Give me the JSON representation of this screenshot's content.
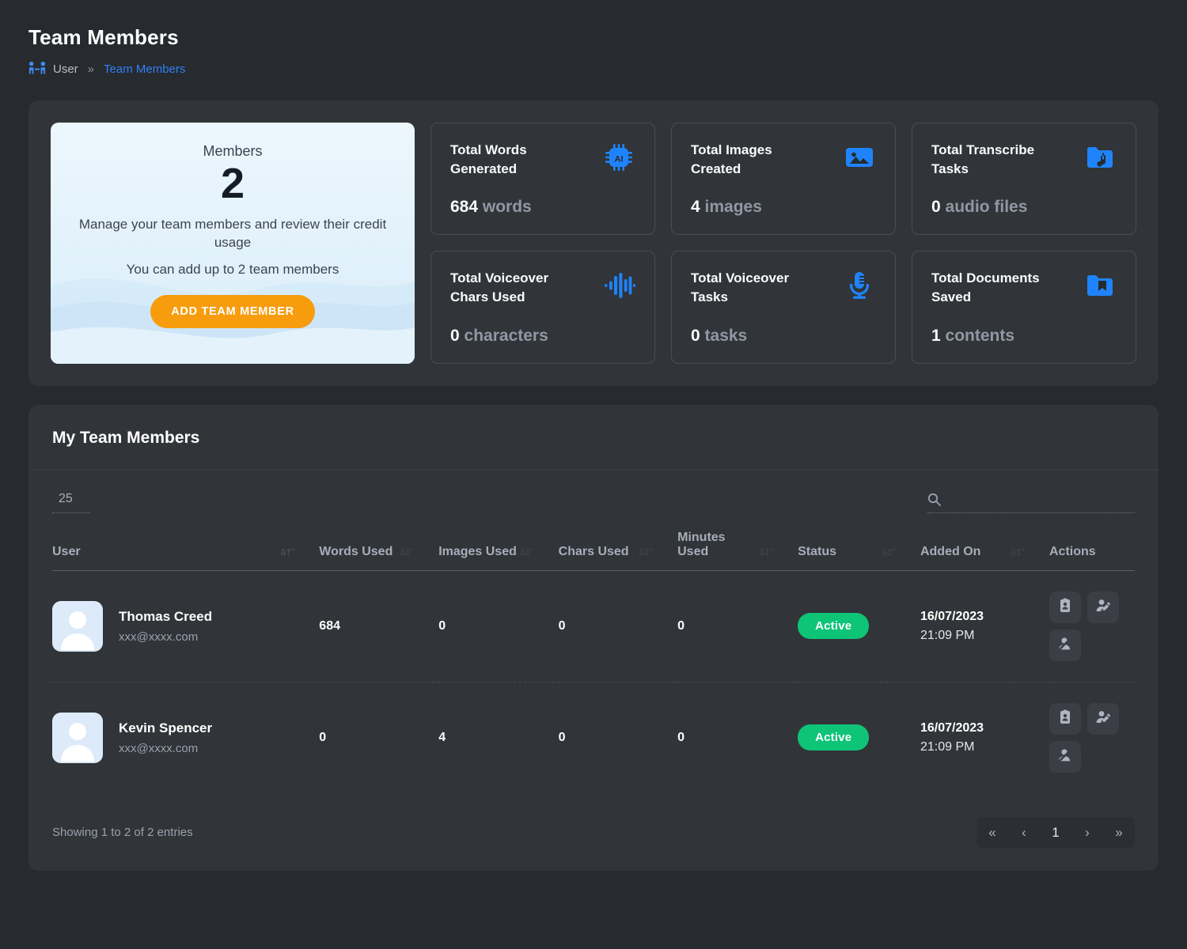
{
  "header": {
    "title": "Team Members",
    "breadcrumb": {
      "icon": "people-arrows-icon",
      "parent": "User",
      "separator": "»",
      "current": "Team Members"
    }
  },
  "members_card": {
    "label": "Members",
    "count": "2",
    "description": "Manage your team members and review their credit usage",
    "limit_text": "You can add up to 2 team members",
    "button_label": "ADD TEAM MEMBER",
    "button_color": "#f79c0c"
  },
  "stats": [
    {
      "title": "Total Words Generated",
      "value": "684",
      "unit": "words",
      "icon": "ai-chip-icon"
    },
    {
      "title": "Total Images Created",
      "value": "4",
      "unit": "images",
      "icon": "image-icon"
    },
    {
      "title": "Total Transcribe Tasks",
      "value": "0",
      "unit": "audio files",
      "icon": "folder-music-icon"
    },
    {
      "title": "Total Voiceover Chars Used",
      "value": "0",
      "unit": "characters",
      "icon": "waveform-icon"
    },
    {
      "title": "Total Voiceover Tasks",
      "value": "0",
      "unit": "tasks",
      "icon": "microphone-icon"
    },
    {
      "title": "Total Documents Saved",
      "value": "1",
      "unit": "contents",
      "icon": "folder-bookmark-icon"
    }
  ],
  "table_section": {
    "title": "My Team Members",
    "page_length": "25",
    "search_placeholder": "",
    "search_value": "",
    "columns": {
      "user": "User",
      "words": "Words Used",
      "images": "Images Used",
      "chars": "Chars Used",
      "minutes": "Minutes Used",
      "status": "Status",
      "added": "Added On",
      "actions": "Actions"
    },
    "sort_glyphs": {
      "primary": "â†\"",
      "secondary": "â‡\""
    },
    "rows": [
      {
        "name": "Thomas Creed",
        "email": "xxx@xxxx.com",
        "words": "684",
        "images": "0",
        "chars": "0",
        "minutes": "0",
        "status": "Active",
        "added_date": "16/07/2023",
        "added_time": "21:09 PM"
      },
      {
        "name": "Kevin Spencer",
        "email": "xxx@xxxx.com",
        "words": "0",
        "images": "4",
        "chars": "0",
        "minutes": "0",
        "status": "Active",
        "added_date": "16/07/2023",
        "added_time": "21:09 PM"
      }
    ],
    "row_actions": [
      "id-card-icon",
      "user-edit-icon",
      "user-slash-icon"
    ],
    "showing_text": "Showing 1 to 2 of 2 entries",
    "pagination": {
      "first": "«",
      "prev": "‹",
      "current": "1",
      "next": "›",
      "last": "»"
    },
    "status_color": "#0ec477",
    "accent_color": "#2f80f7"
  }
}
